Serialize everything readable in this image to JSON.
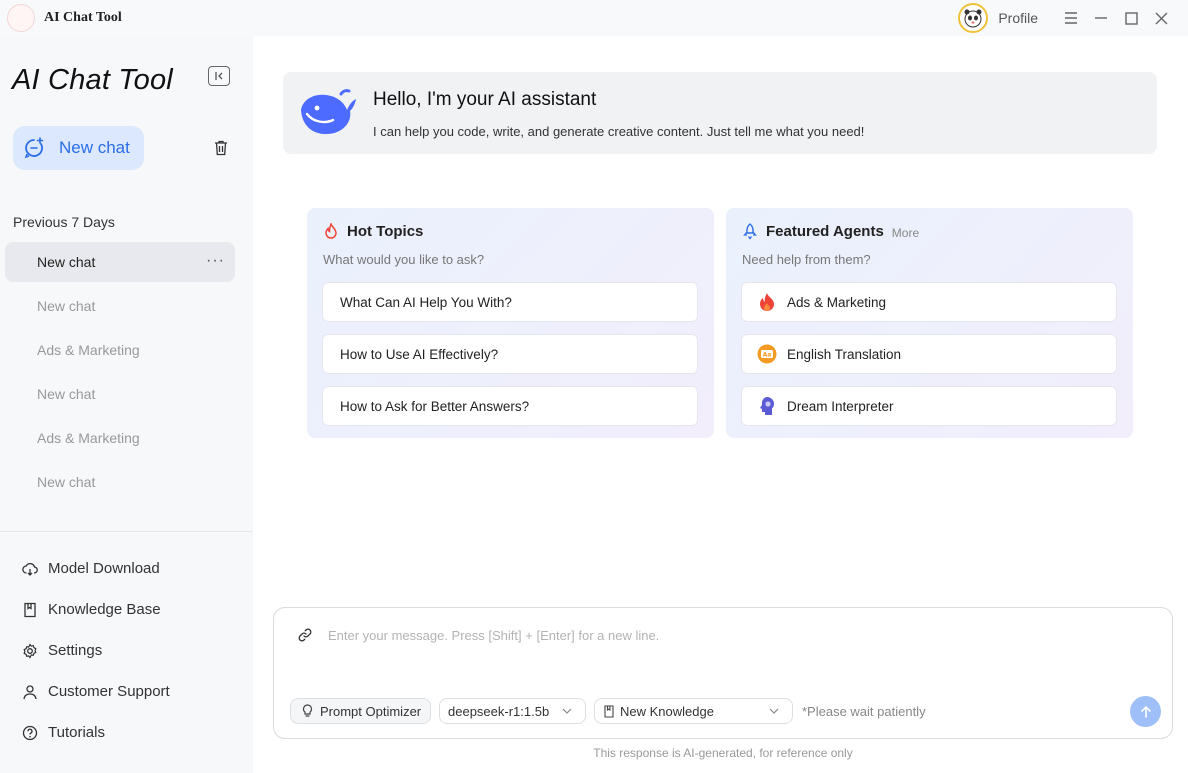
{
  "titlebar": {
    "app_name": "AI Chat Tool",
    "profile_label": "Profile",
    "icons": [
      "panda-avatar-icon",
      "menu-icon",
      "minimize-icon",
      "maximize-icon",
      "close-icon"
    ]
  },
  "sidebar": {
    "brand": "AI Chat Tool",
    "new_chat_label": "New chat",
    "section_label": "Previous 7 Days",
    "history": [
      {
        "label": "New chat",
        "active": true
      },
      {
        "label": "New chat"
      },
      {
        "label": "Ads & Marketing"
      },
      {
        "label": "New chat"
      },
      {
        "label": "Ads & Marketing"
      },
      {
        "label": "New chat"
      }
    ],
    "nav": [
      {
        "label": "Model Download",
        "icon": "cloud-download-icon"
      },
      {
        "label": "Knowledge Base",
        "icon": "book-icon"
      },
      {
        "label": "Settings",
        "icon": "gear-icon"
      },
      {
        "label": "Customer Support",
        "icon": "user-icon"
      },
      {
        "label": "Tutorials",
        "icon": "help-circle-icon"
      }
    ]
  },
  "welcome": {
    "title": "Hello, I'm your AI assistant",
    "description": "I can help you code, write, and generate creative content. Just tell me what you need!"
  },
  "hot_topics": {
    "title": "Hot Topics",
    "subtitle": "What would you like to ask?",
    "items": [
      "What Can AI Help You With?",
      "How to Use AI Effectively?",
      "How to Ask for Better Answers?"
    ]
  },
  "featured_agents": {
    "title": "Featured Agents",
    "more_label": "More",
    "subtitle": "Need help from them?",
    "items": [
      {
        "label": "Ads & Marketing",
        "icon": "flame-icon"
      },
      {
        "label": "English Translation",
        "icon": "translate-icon"
      },
      {
        "label": "Dream Interpreter",
        "icon": "head-icon"
      }
    ]
  },
  "composer": {
    "placeholder": "Enter your message. Press [Shift] + [Enter] for a new line.",
    "prompt_optimizer_label": "Prompt Optimizer",
    "model_value": "deepseek-r1:1.5b",
    "knowledge_value": "New Knowledge",
    "wait_note": "*Please wait patiently"
  },
  "footer": {
    "disclaimer": "This response is AI-generated, for reference only"
  },
  "colors": {
    "accent": "#2b6ee6",
    "new_chat_bg": "#dbe8fd",
    "send_button": "#9ebff7",
    "flame": "#f04438"
  }
}
